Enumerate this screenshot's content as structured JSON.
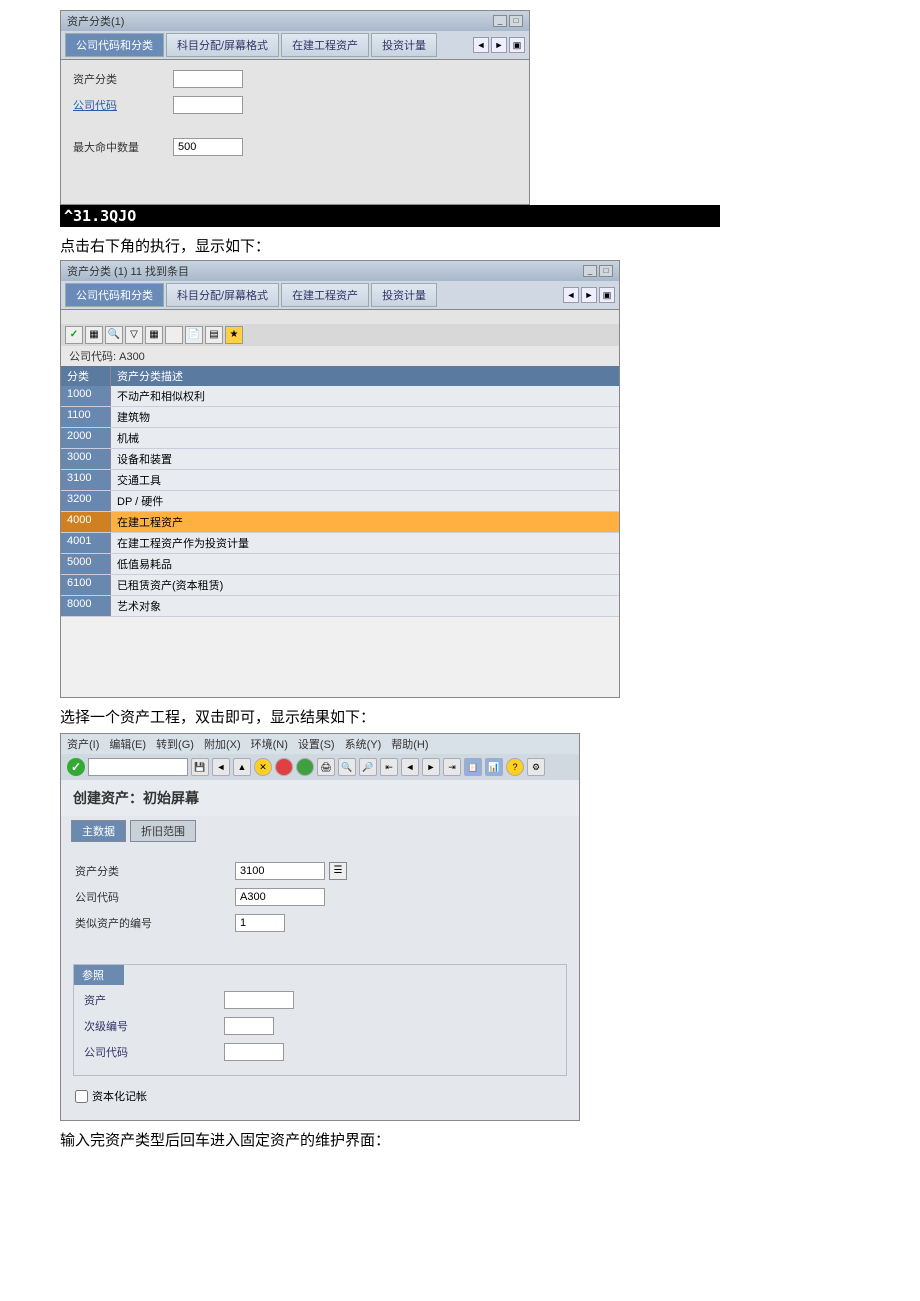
{
  "window1": {
    "title": "资产分类(1)",
    "tabs": [
      "公司代码和分类",
      "科目分配/屏幕格式",
      "在建工程资产",
      "投资计量"
    ],
    "fields": {
      "asset_class_label": "资产分类",
      "company_code_label": "公司代码",
      "company_code_value": "",
      "max_hits_label": "最大命中数量",
      "max_hits_value": "500"
    }
  },
  "blackbar": "^31.3QJO",
  "text1": "点击右下角的执行，显示如下：",
  "window2": {
    "title": "资产分类 (1)   11 找到条目",
    "tabs": [
      "公司代码和分类",
      "科目分配/屏幕格式",
      "在建工程资产",
      "投资计量"
    ],
    "company_line": "公司代码: A300",
    "headers": {
      "col1": "分类",
      "col2": "资产分类描述"
    },
    "rows": [
      {
        "c1": "1000",
        "c2": "不动产和相似权利"
      },
      {
        "c1": "1100",
        "c2": "建筑物"
      },
      {
        "c1": "2000",
        "c2": "机械"
      },
      {
        "c1": "3000",
        "c2": "设备和装置"
      },
      {
        "c1": "3100",
        "c2": "交通工具"
      },
      {
        "c1": "3200",
        "c2": "DP / 硬件"
      },
      {
        "c1": "4000",
        "c2": "在建工程资产",
        "sel": true
      },
      {
        "c1": "4001",
        "c2": "在建工程资产作为投资计量"
      },
      {
        "c1": "5000",
        "c2": "低值易耗品"
      },
      {
        "c1": "6100",
        "c2": "已租赁资产(资本租赁)"
      },
      {
        "c1": "8000",
        "c2": "艺术对象"
      }
    ]
  },
  "text2": "选择一个资产工程，双击即可，显示结果如下：",
  "window3": {
    "menu": [
      "资产(I)",
      "编辑(E)",
      "转到(G)",
      "附加(X)",
      "环境(N)",
      "设置(S)",
      "系统(Y)",
      "帮助(H)"
    ],
    "screen_title": "创建资产：初始屏幕",
    "sub_tabs": [
      "主数据",
      "折旧范围"
    ],
    "fields": {
      "asset_class_label": "资产分类",
      "asset_class_value": "3100",
      "company_code_label": "公司代码",
      "company_code_value": "A300",
      "similar_asset_label": "类似资产的编号",
      "similar_asset_value": "1"
    },
    "group_title": "参照",
    "group_fields": {
      "asset_label": "资产",
      "subnumber_label": "次级编号",
      "company_code_label": "公司代码"
    },
    "checkbox_label": "资本化记帐"
  },
  "text3": "输入完资产类型后回车进入固定资产的维护界面："
}
